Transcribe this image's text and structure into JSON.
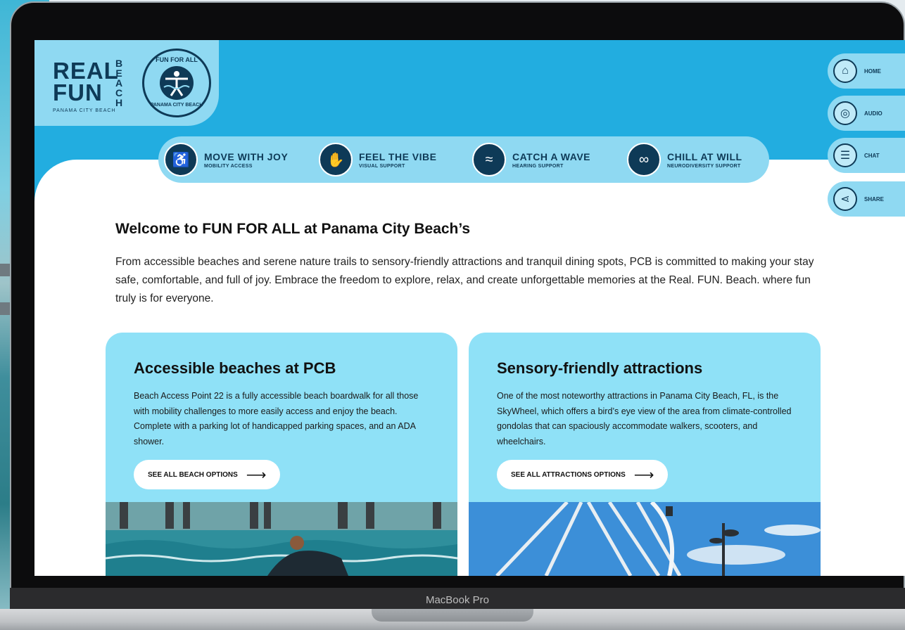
{
  "brand": {
    "logo_lines": [
      "REAL",
      "FUN"
    ],
    "logo_vertical": "BEACH",
    "logo_sub": "PANAMA CITY BEACH",
    "badge_top": "FUN FOR ALL",
    "badge_bottom": "PANAMA CITY BEACH"
  },
  "nav": [
    {
      "title": "MOVE WITH JOY",
      "sub": "MOBILITY ACCESS",
      "icon": "wheelchair-icon"
    },
    {
      "title": "FEEL THE VIBE",
      "sub": "VISUAL SUPPORT",
      "icon": "hand-wave-icon"
    },
    {
      "title": "CATCH A WAVE",
      "sub": "HEARING SUPPORT",
      "icon": "ear-icon"
    },
    {
      "title": "CHILL AT WILL",
      "sub": "NEURODIVERSITY SUPPORT",
      "icon": "infinity-icon"
    }
  ],
  "tools": [
    {
      "label": "HOME",
      "icon": "home-icon"
    },
    {
      "label": "AUDIO",
      "icon": "audio-icon"
    },
    {
      "label": "CHAT",
      "icon": "chat-icon"
    },
    {
      "label": "SHARE",
      "icon": "share-icon"
    }
  ],
  "main": {
    "title": "Welcome to FUN FOR ALL at Panama City Beach’s",
    "intro": "From accessible beaches and serene nature trails to sensory-friendly attractions and tranquil dining spots, PCB is committed to making your stay safe, comfortable, and full of joy. Embrace the freedom to explore, relax, and create unforgettable memories at the Real. FUN. Beach. where fun truly is for everyone."
  },
  "cards": [
    {
      "title": "Accessible beaches at PCB",
      "body": "Beach Access Point 22 is a fully accessible beach boardwalk for all those with mobility challenges to more easily access and enjoy the beach. Complete with a parking lot of handicapped parking spaces, and an ADA shower.",
      "cta": "SEE ALL BEACH OPTIONS"
    },
    {
      "title": "Sensory-friendly attractions",
      "body": "One of the most noteworthy attractions in Panama City Beach, FL, is the SkyWheel, which offers a bird’s eye view of the area from climate-controlled gondolas that can spaciously accommodate walkers, scooters, and wheelchairs.",
      "cta": "SEE ALL ATTRACTIONS OPTIONS"
    }
  ],
  "device": {
    "label": "MacBook Pro"
  },
  "colors": {
    "header_blue": "#22ade0",
    "light_blue": "#8fd9f2",
    "card_blue": "#8fe1f7",
    "navy": "#0e3a57"
  }
}
